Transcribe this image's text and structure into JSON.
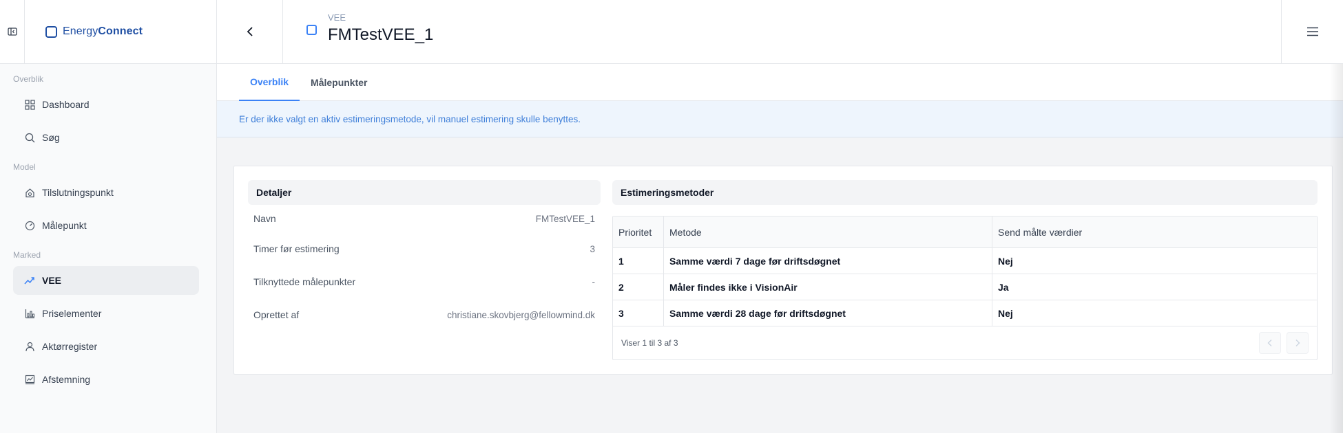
{
  "brand": {
    "name_light": "Energy",
    "name_bold": "Connect",
    "accent": "#1f4fa3"
  },
  "sidebar": {
    "sections": [
      {
        "label": "Overblik",
        "items": [
          {
            "label": "Dashboard",
            "icon": "grid-icon"
          },
          {
            "label": "Søg",
            "icon": "search-icon"
          }
        ]
      },
      {
        "label": "Model",
        "items": [
          {
            "label": "Tilslutningspunkt",
            "icon": "house-icon"
          },
          {
            "label": "Målepunkt",
            "icon": "gauge-icon"
          }
        ]
      },
      {
        "label": "Marked",
        "items": [
          {
            "label": "VEE",
            "icon": "trend-icon",
            "active": true
          },
          {
            "label": "Priselementer",
            "icon": "bar-chart-icon"
          },
          {
            "label": "Aktørregister",
            "icon": "user-icon"
          },
          {
            "label": "Afstemning",
            "icon": "chart-icon"
          }
        ]
      }
    ]
  },
  "header": {
    "subtitle": "VEE",
    "title": "FMTestVEE_1"
  },
  "tabs": [
    {
      "label": "Overblik",
      "active": true
    },
    {
      "label": "Målepunkter",
      "active": false
    }
  ],
  "banner": {
    "text": "Er der ikke valgt en aktiv estimeringsmetode, vil manuel estimering skulle benyttes."
  },
  "details": {
    "title": "Detaljer",
    "rows": [
      {
        "key": "Navn",
        "value": "FMTestVEE_1"
      },
      {
        "key": "Timer før estimering",
        "value": "3"
      },
      {
        "key": "Tilknyttede målepunkter",
        "value": "-"
      },
      {
        "key": "Oprettet af",
        "value": "christiane.skovbjerg@fellowmind.dk"
      }
    ]
  },
  "methods": {
    "title": "Estimeringsmetoder",
    "columns": [
      "Prioritet",
      "Metode",
      "Send målte værdier"
    ],
    "rows": [
      [
        "1",
        "Samme værdi 7 dage før driftsdøgnet",
        "Nej"
      ],
      [
        "2",
        "Måler findes ikke i VisionAir",
        "Ja"
      ],
      [
        "3",
        "Samme værdi 28 dage før driftsdøgnet",
        "Nej"
      ]
    ],
    "footer": "Viser 1 til 3 af 3"
  },
  "colors": {
    "primary": "#3b82f6",
    "banner_bg": "#eef5fd",
    "banner_text": "#3f7fd9"
  }
}
